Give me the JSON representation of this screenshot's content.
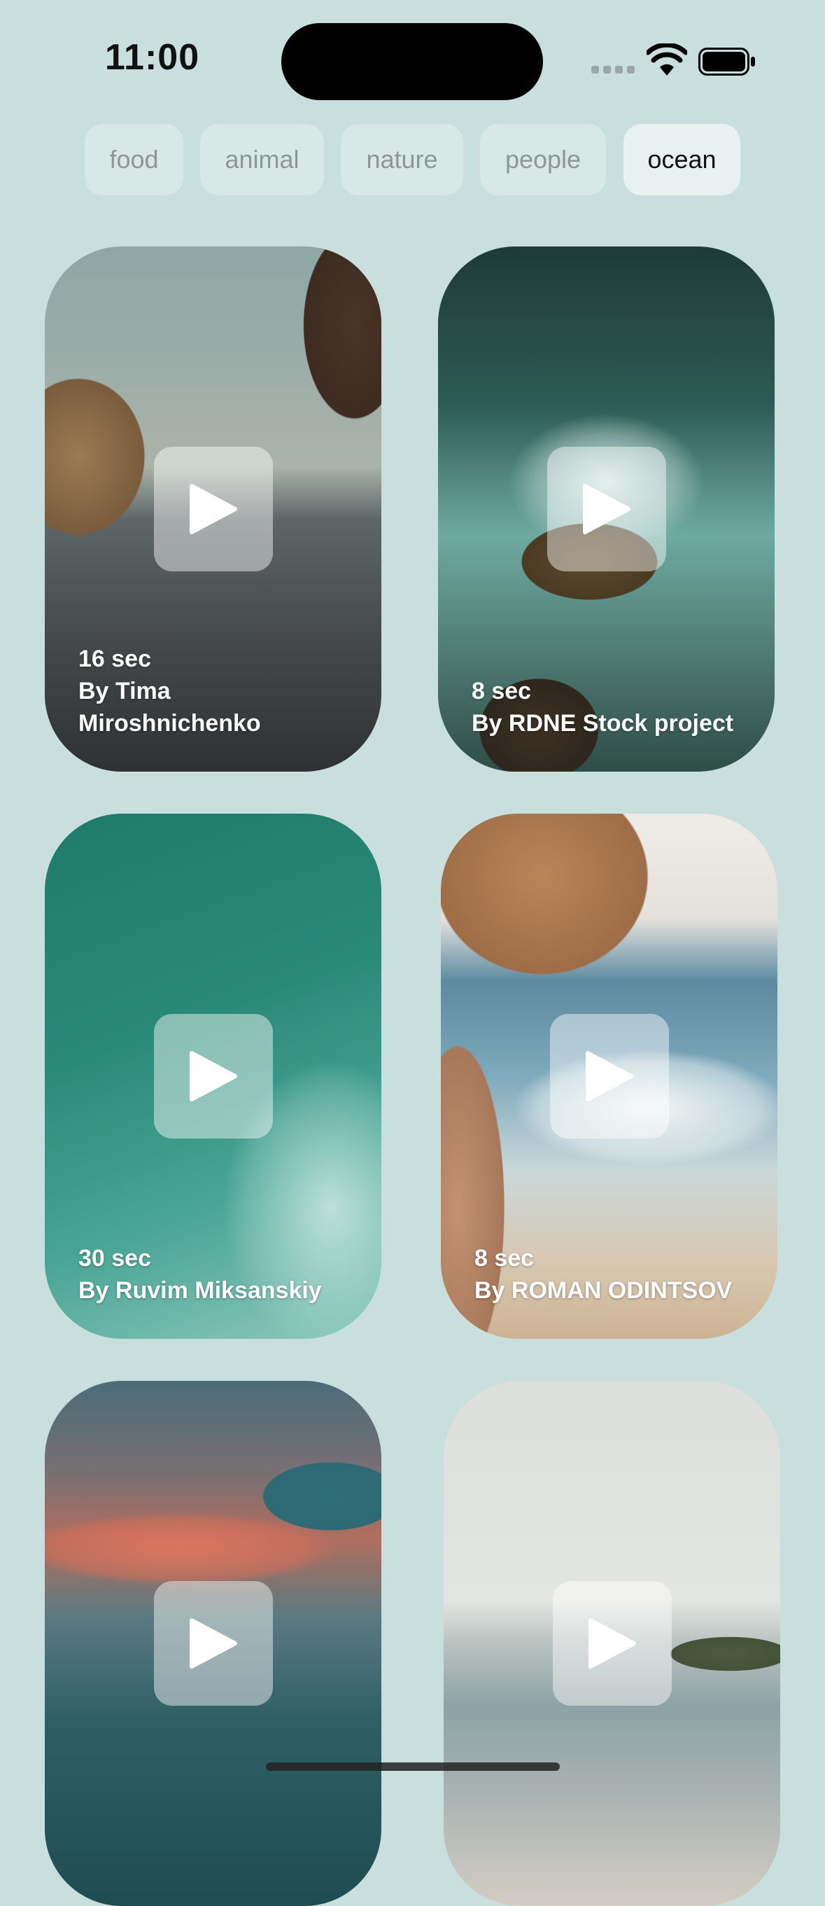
{
  "status_bar": {
    "time": "11:00"
  },
  "categories": [
    {
      "label": "food",
      "selected": false
    },
    {
      "label": "animal",
      "selected": false
    },
    {
      "label": "nature",
      "selected": false
    },
    {
      "label": "people",
      "selected": false
    },
    {
      "label": "ocean",
      "selected": true
    }
  ],
  "videos": [
    {
      "duration": "16 sec",
      "author_line1": "By Tima",
      "author_line2": "Miroshnichenko"
    },
    {
      "duration": "8 sec",
      "author_line1": "By RDNE Stock project",
      "author_line2": ""
    },
    {
      "duration": "30 sec",
      "author_line1": "By Ruvim Miksanskiy",
      "author_line2": ""
    },
    {
      "duration": "8 sec",
      "author_line1": "By ROMAN ODINTSOV",
      "author_line2": ""
    },
    {
      "duration": "",
      "author_line1": "",
      "author_line2": ""
    },
    {
      "duration": "",
      "author_line1": "",
      "author_line2": ""
    }
  ],
  "icons": {
    "play": "play-icon",
    "wifi": "wifi-icon",
    "battery": "battery-icon",
    "signal": "cellular-signal-icon"
  },
  "colors": {
    "background": "#c8dfde",
    "selected_tab_text": "#111111",
    "tab_text": "#8c9797"
  }
}
